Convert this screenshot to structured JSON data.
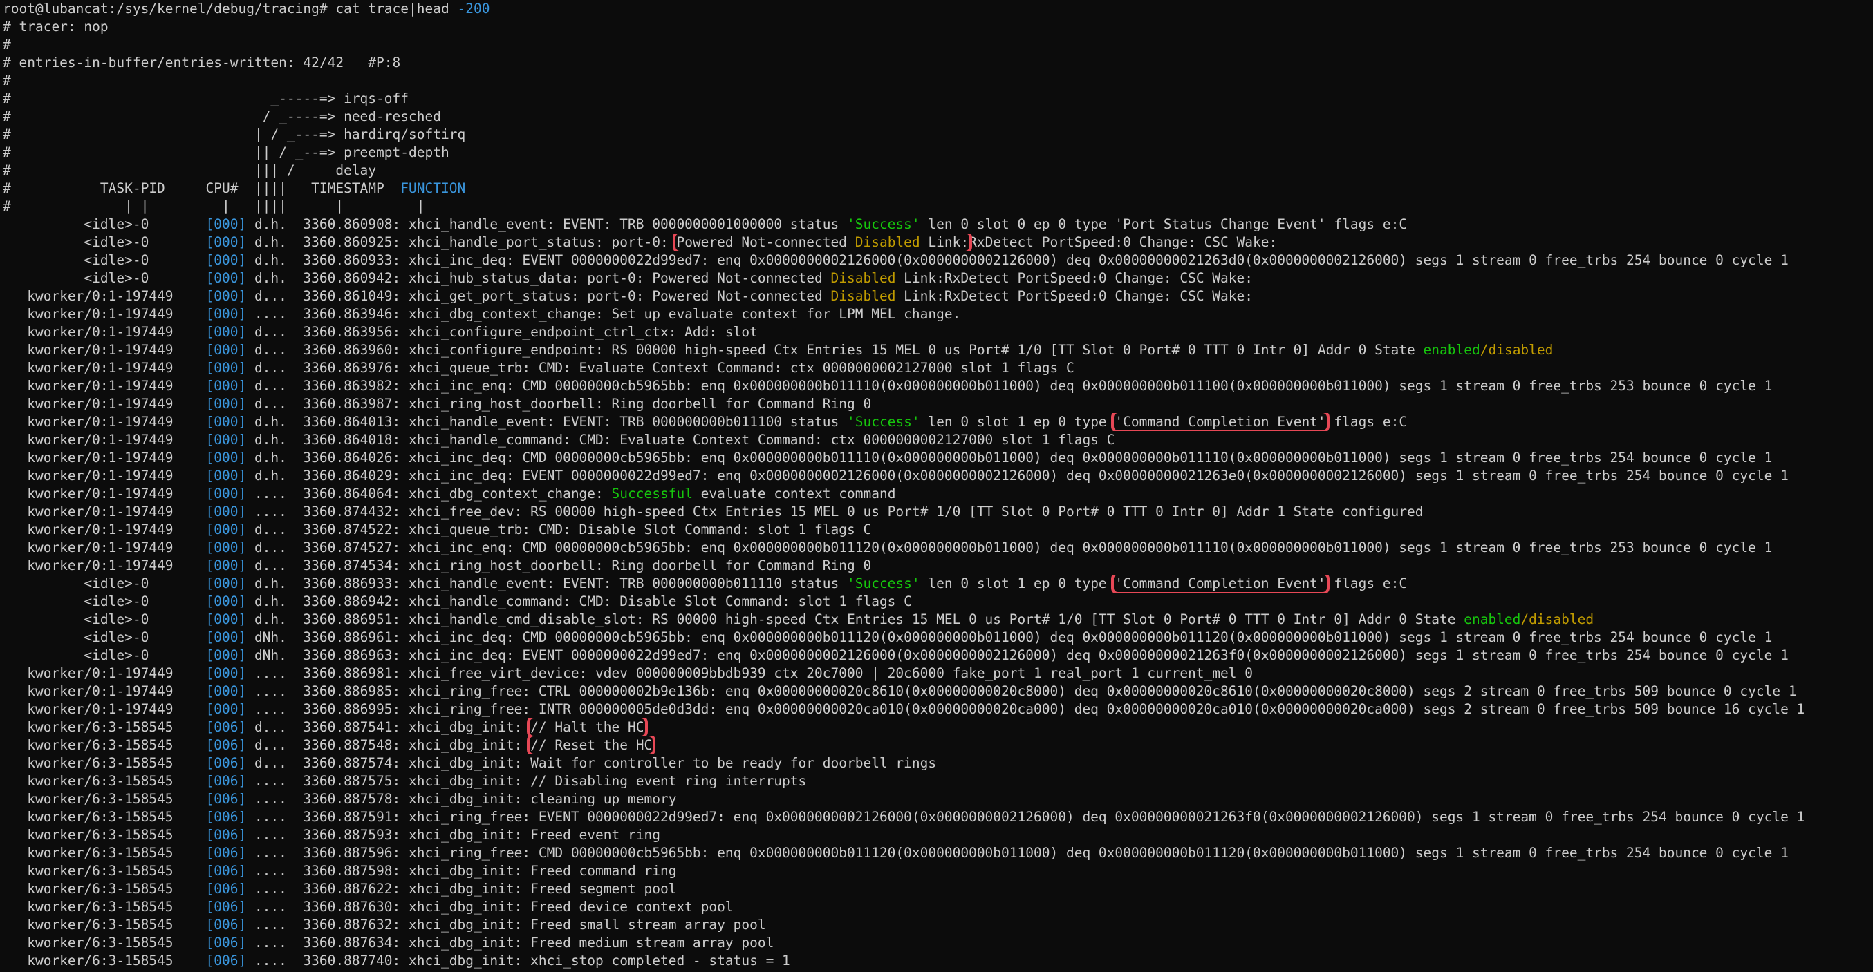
{
  "terminal": {
    "prompt": "root@lubancat:/sys/kernel/debug/tracing#",
    "command_pre": " cat trace",
    "command_pipe": "|",
    "command_post": "head ",
    "command_arg": "-200"
  },
  "header_lines": [
    "# tracer: nop",
    "#",
    "# entries-in-buffer/entries-written: 42/42   #P:8",
    "#",
    "#                                _-----=> irqs-off",
    "#                               / _----=> need-resched",
    "#                              | / _---=> hardirq/softirq",
    "#                              || / _--=> preempt-depth",
    "#                              ||| /     delay",
    "#           TASK-PID     CPU#  ||||   TIMESTAMP  ",
    "#              | |         |   ||||      |         |"
  ],
  "function_header": "FUNCTION",
  "status_words": {
    "success": "Success",
    "successful": "Successful",
    "disabled": "Disabled",
    "enabled": "enabled",
    "slash": "/",
    "disabled_lc": "disabled"
  },
  "rows": [
    {
      "task": "          <idle>-0       ",
      "cpu": "[000]",
      "flags": " d.h.  ",
      "ts": "3360.860908:",
      "func": " xhci_handle_event: EVENT: TRB 0000000001000000 status "
    },
    {
      "task": "          <idle>-0       ",
      "cpu": "[000]",
      "flags": " d.h.  ",
      "ts": "3360.860925:",
      "func": " xhci_handle_port_status: port-0: "
    },
    {
      "task": "          <idle>-0       ",
      "cpu": "[000]",
      "flags": " d.h.  ",
      "ts": "3360.860933:",
      "func": " xhci_inc_deq: EVENT 0000000022d99ed7: enq 0x0000000002126000(0x0000000002126000) deq 0x00000000021263d0(0x0000000002126000) segs 1 stream 0 free_trbs 254 bounce 0 cycle 1"
    },
    {
      "task": "          <idle>-0       ",
      "cpu": "[000]",
      "flags": " d.h.  ",
      "ts": "3360.860942:",
      "func": " xhci_hub_status_data: port-0: Powered Not-connected "
    },
    {
      "task": "   kworker/0:1-197449    ",
      "cpu": "[000]",
      "flags": " d...  ",
      "ts": "3360.861049:",
      "func": " xhci_get_port_status: port-0: Powered Not-connected "
    },
    {
      "task": "   kworker/0:1-197449    ",
      "cpu": "[000]",
      "flags": " ....  ",
      "ts": "3360.863946:",
      "func": " xhci_dbg_context_change: Set up evaluate context for LPM MEL change."
    },
    {
      "task": "   kworker/0:1-197449    ",
      "cpu": "[000]",
      "flags": " d...  ",
      "ts": "3360.863956:",
      "func": " xhci_configure_endpoint_ctrl_ctx: Add: slot"
    },
    {
      "task": "   kworker/0:1-197449    ",
      "cpu": "[000]",
      "flags": " d...  ",
      "ts": "3360.863960:",
      "func": " xhci_configure_endpoint: RS 00000 high-speed Ctx Entries 15 MEL 0 us Port# 1/0 [TT Slot 0 Port# 0 TTT 0 Intr 0] Addr 0 State "
    },
    {
      "task": "   kworker/0:1-197449    ",
      "cpu": "[000]",
      "flags": " d...  ",
      "ts": "3360.863976:",
      "func": " xhci_queue_trb: CMD: Evaluate Context Command: ctx 0000000002127000 slot 1 flags C"
    },
    {
      "task": "   kworker/0:1-197449    ",
      "cpu": "[000]",
      "flags": " d...  ",
      "ts": "3360.863982:",
      "func": " xhci_inc_enq: CMD 00000000cb5965bb: enq 0x000000000b011110(0x000000000b011000) deq 0x000000000b011100(0x000000000b011000) segs 1 stream 0 free_trbs 253 bounce 0 cycle 1"
    },
    {
      "task": "   kworker/0:1-197449    ",
      "cpu": "[000]",
      "flags": " d...  ",
      "ts": "3360.863987:",
      "func": " xhci_ring_host_doorbell: Ring doorbell for Command Ring 0"
    },
    {
      "task": "   kworker/0:1-197449    ",
      "cpu": "[000]",
      "flags": " d.h.  ",
      "ts": "3360.864013:",
      "func": " xhci_handle_event: EVENT: TRB 000000000b011100 status "
    },
    {
      "task": "   kworker/0:1-197449    ",
      "cpu": "[000]",
      "flags": " d.h.  ",
      "ts": "3360.864018:",
      "func": " xhci_handle_command: CMD: Evaluate Context Command: ctx 0000000002127000 slot 1 flags C"
    },
    {
      "task": "   kworker/0:1-197449    ",
      "cpu": "[000]",
      "flags": " d.h.  ",
      "ts": "3360.864026:",
      "func": " xhci_inc_deq: CMD 00000000cb5965bb: enq 0x000000000b011110(0x000000000b011000) deq 0x000000000b011110(0x000000000b011000) segs 1 stream 0 free_trbs 254 bounce 0 cycle 1"
    },
    {
      "task": "   kworker/0:1-197449    ",
      "cpu": "[000]",
      "flags": " d.h.  ",
      "ts": "3360.864029:",
      "func": " xhci_inc_deq: EVENT 0000000022d99ed7: enq 0x0000000002126000(0x0000000002126000) deq 0x00000000021263e0(0x0000000002126000) segs 1 stream 0 free_trbs 254 bounce 0 cycle 1"
    },
    {
      "task": "   kworker/0:1-197449    ",
      "cpu": "[000]",
      "flags": " ....  ",
      "ts": "3360.864064:",
      "func": " xhci_dbg_context_change: "
    },
    {
      "task": "   kworker/0:1-197449    ",
      "cpu": "[000]",
      "flags": " ....  ",
      "ts": "3360.874432:",
      "func": " xhci_free_dev: RS 00000 high-speed Ctx Entries 15 MEL 0 us Port# 1/0 [TT Slot 0 Port# 0 TTT 0 Intr 0] Addr 1 State configured"
    },
    {
      "task": "   kworker/0:1-197449    ",
      "cpu": "[000]",
      "flags": " d...  ",
      "ts": "3360.874522:",
      "func": " xhci_queue_trb: CMD: Disable Slot Command: slot 1 flags C"
    },
    {
      "task": "   kworker/0:1-197449    ",
      "cpu": "[000]",
      "flags": " d...  ",
      "ts": "3360.874527:",
      "func": " xhci_inc_enq: CMD 00000000cb5965bb: enq 0x000000000b011120(0x000000000b011000) deq 0x000000000b011110(0x000000000b011000) segs 1 stream 0 free_trbs 253 bounce 0 cycle 1"
    },
    {
      "task": "   kworker/0:1-197449    ",
      "cpu": "[000]",
      "flags": " d...  ",
      "ts": "3360.874534:",
      "func": " xhci_ring_host_doorbell: Ring doorbell for Command Ring 0"
    },
    {
      "task": "          <idle>-0       ",
      "cpu": "[000]",
      "flags": " d.h.  ",
      "ts": "3360.886933:",
      "func": " xhci_handle_event: EVENT: TRB 000000000b011110 status "
    },
    {
      "task": "          <idle>-0       ",
      "cpu": "[000]",
      "flags": " d.h.  ",
      "ts": "3360.886942:",
      "func": " xhci_handle_command: CMD: Disable Slot Command: slot 1 flags C"
    },
    {
      "task": "          <idle>-0       ",
      "cpu": "[000]",
      "flags": " d.h.  ",
      "ts": "3360.886951:",
      "func": " xhci_handle_cmd_disable_slot: RS 00000 high-speed Ctx Entries 15 MEL 0 us Port# 1/0 [TT Slot 0 Port# 0 TTT 0 Intr 0] Addr 0 State "
    },
    {
      "task": "          <idle>-0       ",
      "cpu": "[000]",
      "flags": " dNh.  ",
      "ts": "3360.886961:",
      "func": " xhci_inc_deq: CMD 00000000cb5965bb: enq 0x000000000b011120(0x000000000b011000) deq 0x000000000b011120(0x000000000b011000) segs 1 stream 0 free_trbs 254 bounce 0 cycle 1"
    },
    {
      "task": "          <idle>-0       ",
      "cpu": "[000]",
      "flags": " dNh.  ",
      "ts": "3360.886963:",
      "func": " xhci_inc_deq: EVENT 0000000022d99ed7: enq 0x0000000002126000(0x0000000002126000) deq 0x00000000021263f0(0x0000000002126000) segs 1 stream 0 free_trbs 254 bounce 0 cycle 1"
    },
    {
      "task": "   kworker/0:1-197449    ",
      "cpu": "[000]",
      "flags": " ....  ",
      "ts": "3360.886981:",
      "func": " xhci_free_virt_device: vdev 000000009bbdb939 ctx 20c7000 | 20c6000 fake_port 1 real_port 1 current_mel 0"
    },
    {
      "task": "   kworker/0:1-197449    ",
      "cpu": "[000]",
      "flags": " ....  ",
      "ts": "3360.886985:",
      "func": " xhci_ring_free: CTRL 000000002b9e136b: enq 0x00000000020c8610(0x00000000020c8000) deq 0x00000000020c8610(0x00000000020c8000) segs 2 stream 0 free_trbs 509 bounce 0 cycle 1"
    },
    {
      "task": "   kworker/0:1-197449    ",
      "cpu": "[000]",
      "flags": " ....  ",
      "ts": "3360.886995:",
      "func": " xhci_ring_free: INTR 000000005de0d3dd: enq 0x00000000020ca010(0x00000000020ca000) deq 0x00000000020ca010(0x00000000020ca000) segs 2 stream 0 free_trbs 509 bounce 16 cycle 1"
    },
    {
      "task": "   kworker/6:3-158545    ",
      "cpu": "[006]",
      "flags": " d...  ",
      "ts": "3360.887541:",
      "func": " xhci_dbg_init: "
    },
    {
      "task": "   kworker/6:3-158545    ",
      "cpu": "[006]",
      "flags": " d...  ",
      "ts": "3360.887548:",
      "func": " xhci_dbg_init: "
    },
    {
      "task": "   kworker/6:3-158545    ",
      "cpu": "[006]",
      "flags": " d...  ",
      "ts": "3360.887574:",
      "func": " xhci_dbg_init: Wait for controller to be ready for doorbell rings"
    },
    {
      "task": "   kworker/6:3-158545    ",
      "cpu": "[006]",
      "flags": " ....  ",
      "ts": "3360.887575:",
      "func": " xhci_dbg_init: // Disabling event ring interrupts"
    },
    {
      "task": "   kworker/6:3-158545    ",
      "cpu": "[006]",
      "flags": " ....  ",
      "ts": "3360.887578:",
      "func": " xhci_dbg_init: cleaning up memory"
    },
    {
      "task": "   kworker/6:3-158545    ",
      "cpu": "[006]",
      "flags": " ....  ",
      "ts": "3360.887591:",
      "func": " xhci_ring_free: EVENT 0000000022d99ed7: enq 0x0000000002126000(0x0000000002126000) deq 0x00000000021263f0(0x0000000002126000) segs 1 stream 0 free_trbs 254 bounce 0 cycle 1"
    },
    {
      "task": "   kworker/6:3-158545    ",
      "cpu": "[006]",
      "flags": " ....  ",
      "ts": "3360.887593:",
      "func": " xhci_dbg_init: Freed event ring"
    },
    {
      "task": "   kworker/6:3-158545    ",
      "cpu": "[006]",
      "flags": " ....  ",
      "ts": "3360.887596:",
      "func": " xhci_ring_free: CMD 00000000cb5965bb: enq 0x000000000b011120(0x000000000b011000) deq 0x000000000b011120(0x000000000b011000) segs 1 stream 0 free_trbs 254 bounce 0 cycle 1"
    },
    {
      "task": "   kworker/6:3-158545    ",
      "cpu": "[006]",
      "flags": " ....  ",
      "ts": "3360.887598:",
      "func": " xhci_dbg_init: Freed command ring"
    },
    {
      "task": "   kworker/6:3-158545    ",
      "cpu": "[006]",
      "flags": " ....  ",
      "ts": "3360.887622:",
      "func": " xhci_dbg_init: Freed segment pool"
    },
    {
      "task": "   kworker/6:3-158545    ",
      "cpu": "[006]",
      "flags": " ....  ",
      "ts": "3360.887630:",
      "func": " xhci_dbg_init: Freed device context pool"
    },
    {
      "task": "   kworker/6:3-158545    ",
      "cpu": "[006]",
      "flags": " ....  ",
      "ts": "3360.887632:",
      "func": " xhci_dbg_init: Freed small stream array pool"
    },
    {
      "task": "   kworker/6:3-158545    ",
      "cpu": "[006]",
      "flags": " ....  ",
      "ts": "3360.887634:",
      "func": " xhci_dbg_init: Freed medium stream array pool"
    },
    {
      "task": "   kworker/6:3-158545    ",
      "cpu": "[006]",
      "flags": " ....  ",
      "ts": "3360.887740:",
      "func": " xhci_dbg_init: xhci_stop completed - status = 1"
    }
  ],
  "row_tails": {
    "r0": " len 0 slot 0 ep 0 type 'Port Status Change Event' flags e:C",
    "r1_hl_pre": "Powered Not-connected ",
    "r1_hl_post": " Link:",
    "r1_post": "RxDetect PortSpeed:0 Change: CSC Wake:",
    "r3_post": " Link:RxDetect PortSpeed:0 Change: CSC Wake:",
    "r4_post": " Link:RxDetect PortSpeed:0 Change: CSC Wake:",
    "r11_mid": " len 0 slot 1 ep 0 type ",
    "r11_hl": "'Command Completion Event'",
    "r11_post": " flags e:C",
    "r15_post": " evaluate context command",
    "r20_mid": " len 0 slot 1 ep 0 type ",
    "r20_hl": "'Command Completion Event'",
    "r20_post": " flags e:C",
    "r28_hl": "// Halt the HC",
    "r29_hl": "// Reset the HC"
  },
  "quote_success": "'Success'",
  "partial_last_line": "    kworker/6:3-158545    [006] ....  3360.887740"
}
